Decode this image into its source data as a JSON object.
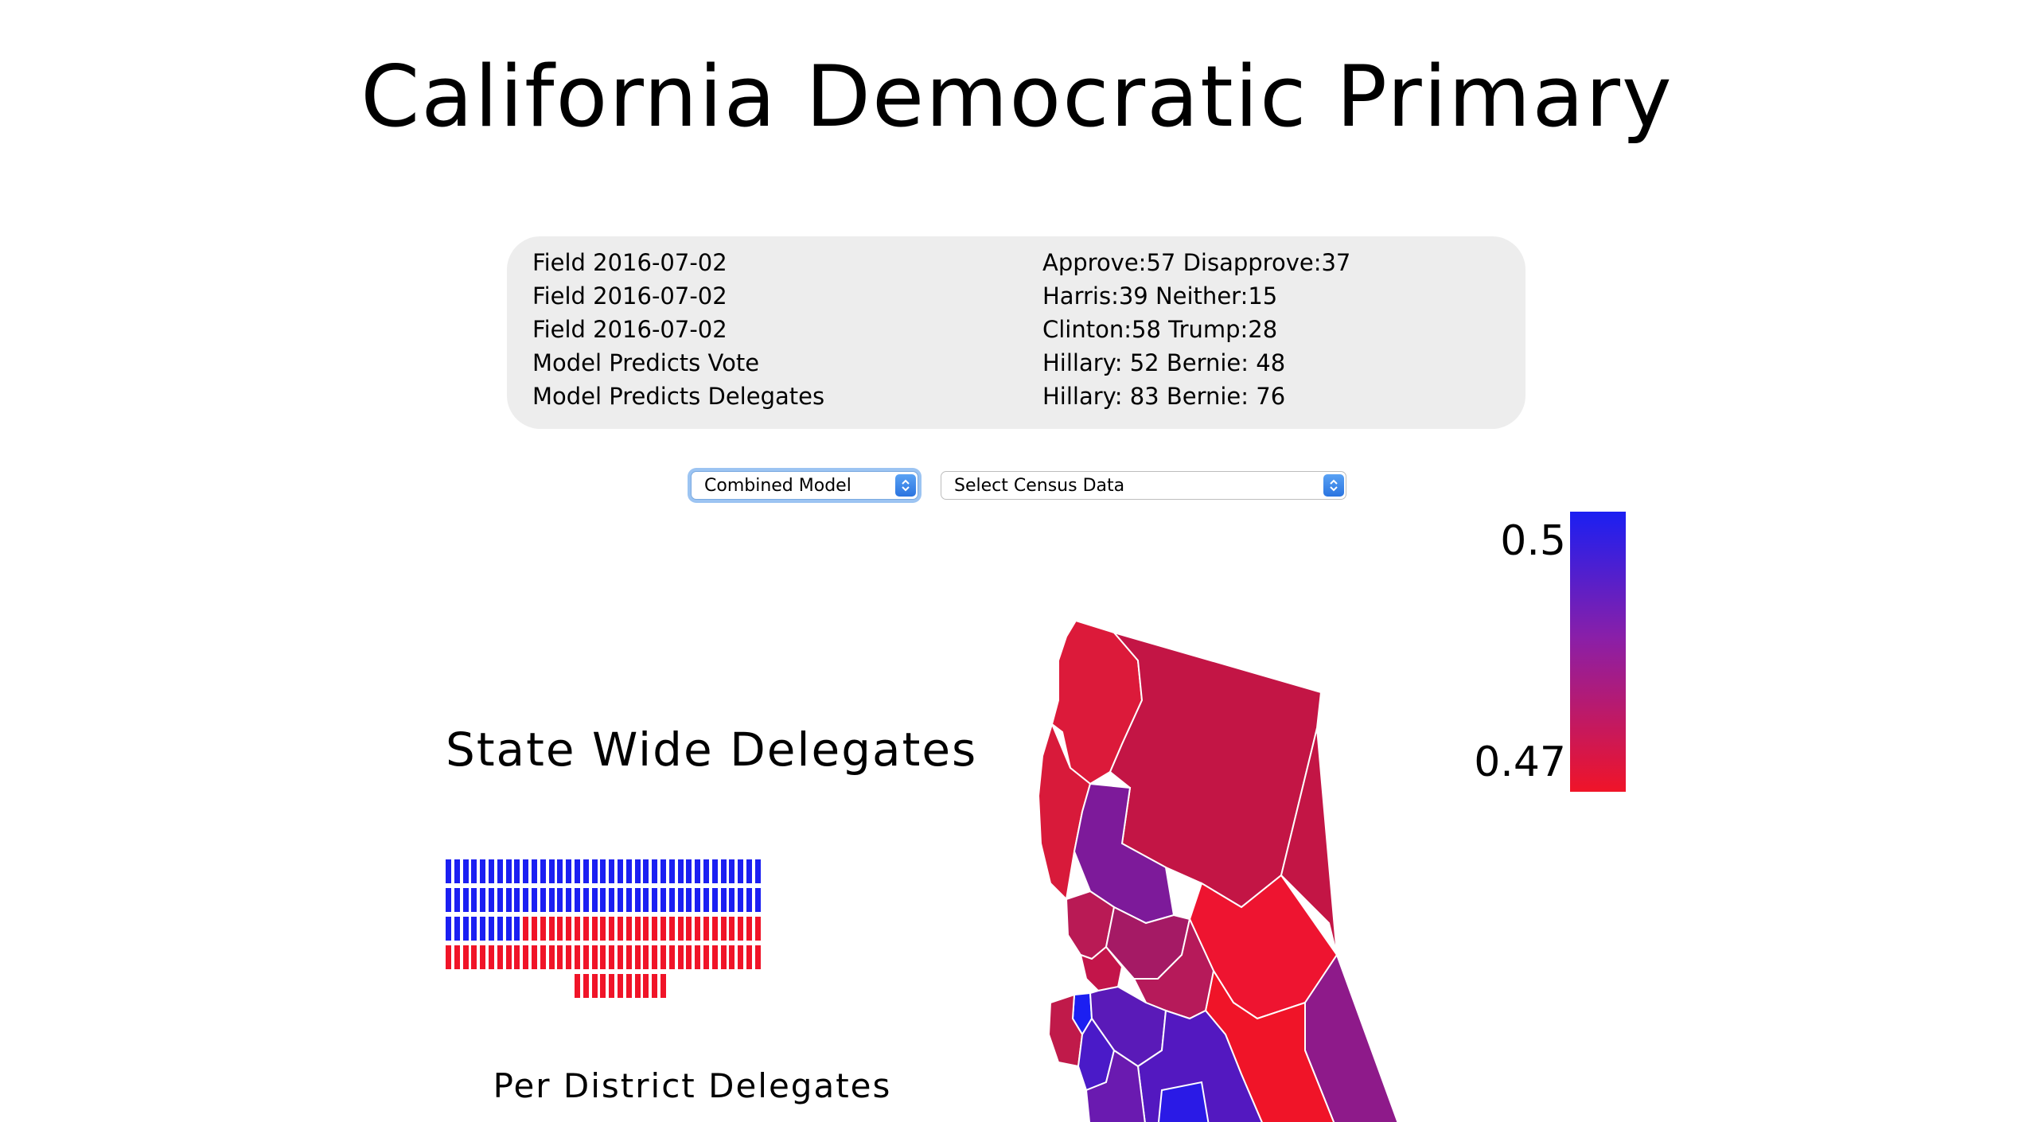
{
  "title": "California Democratic Primary",
  "polls": [
    {
      "label": "Field 2016-07-02",
      "value": "Approve:57 Disapprove:37"
    },
    {
      "label": "Field 2016-07-02",
      "value": "Harris:39 Neither:15"
    },
    {
      "label": "Field 2016-07-02",
      "value": "Clinton:58 Trump:28"
    },
    {
      "label": "Model Predicts Vote",
      "value": "Hillary: 52 Bernie: 48"
    },
    {
      "label": "Model Predicts Delegates",
      "value": "Hillary: 83 Bernie: 76"
    }
  ],
  "controls": {
    "model_select": {
      "value": "Combined Model"
    },
    "census_select": {
      "value": "Select Census Data"
    }
  },
  "legend": {
    "max_label": "0.5",
    "min_label": "0.47",
    "colors": {
      "high": "#1b1ff2",
      "mid": "#8a1fa8",
      "low": "#f01428"
    }
  },
  "statewide": {
    "title": "State Wide Delegates",
    "hillary": 83,
    "bernie": 76,
    "hillary_color": "#1b1ff2",
    "bernie_color": "#f01428"
  },
  "per_district": {
    "title": "Per District Delegates"
  },
  "map": {
    "name": "california-county-map"
  }
}
